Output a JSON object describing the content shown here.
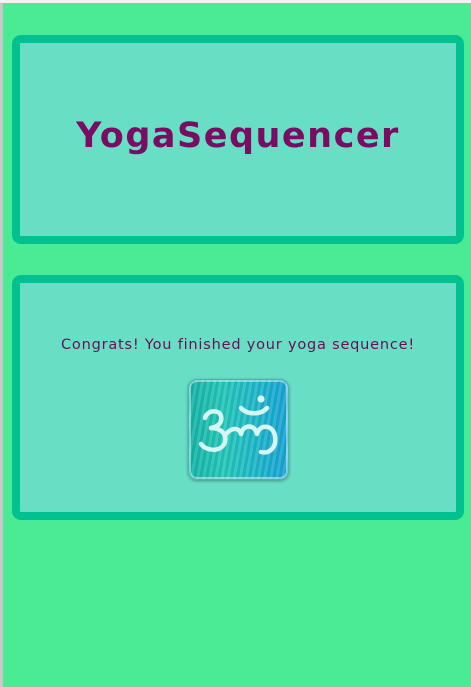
{
  "header": {
    "title": "YogaSequencer"
  },
  "main": {
    "message": "Congrats! You finished your yoga sequence!",
    "om_button_icon": "om-icon"
  },
  "colors": {
    "background": "#4aeb94",
    "panel_fill": "#68dfc4",
    "panel_border": "#00c18f",
    "text": "#7a0d63",
    "icon_fill": "#d6f6f4"
  }
}
